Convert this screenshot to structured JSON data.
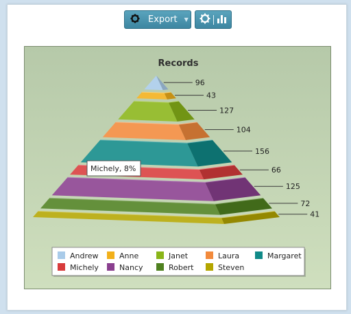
{
  "toolbar": {
    "export_label": "Export",
    "export_icon": "gear-icon",
    "settings_icon": "gear-icon",
    "chart_icon": "bar-chart-icon"
  },
  "tooltip": {
    "text": "Michely, 8%"
  },
  "chart_data": {
    "type": "pyramid",
    "title": "Records",
    "categories": [
      "Andrew",
      "Anne",
      "Janet",
      "Laura",
      "Margaret",
      "Michely",
      "Nancy",
      "Robert",
      "Steven"
    ],
    "values": [
      96,
      43,
      127,
      104,
      156,
      66,
      125,
      72,
      41
    ],
    "colors": [
      "#a9cbe9",
      "#f2b01a",
      "#8ab518",
      "#f28a3c",
      "#108a88",
      "#d83c3c",
      "#8a3f8f",
      "#4f8120",
      "#b4a600"
    ],
    "legend": "bottom"
  }
}
